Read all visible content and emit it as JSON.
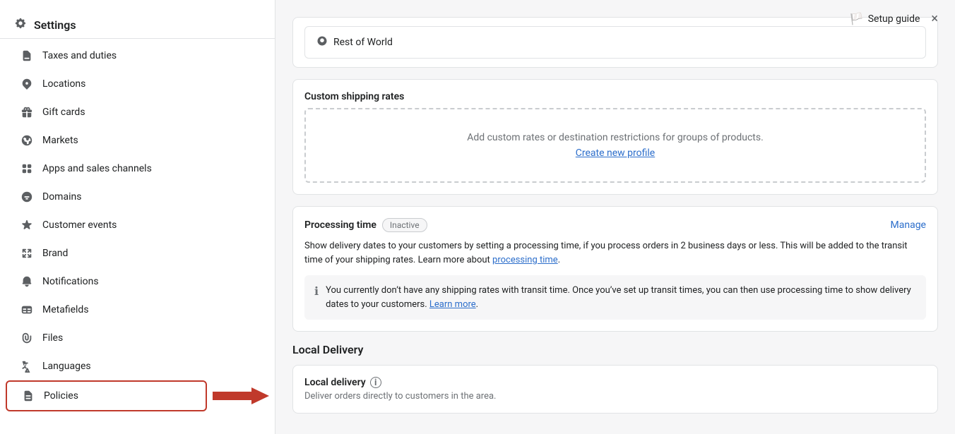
{
  "header": {
    "title": "Settings",
    "setup_guide_label": "Setup guide",
    "close_label": "×"
  },
  "sidebar": {
    "items": [
      {
        "id": "taxes",
        "label": "Taxes and duties",
        "icon": "tax"
      },
      {
        "id": "locations",
        "label": "Locations",
        "icon": "location"
      },
      {
        "id": "gift-cards",
        "label": "Gift cards",
        "icon": "gift"
      },
      {
        "id": "markets",
        "label": "Markets",
        "icon": "globe"
      },
      {
        "id": "apps",
        "label": "Apps and sales channels",
        "icon": "apps"
      },
      {
        "id": "domains",
        "label": "Domains",
        "icon": "globe2"
      },
      {
        "id": "customer-events",
        "label": "Customer events",
        "icon": "star"
      },
      {
        "id": "brand",
        "label": "Brand",
        "icon": "brand"
      },
      {
        "id": "notifications",
        "label": "Notifications",
        "icon": "bell"
      },
      {
        "id": "metafields",
        "label": "Metafields",
        "icon": "table"
      },
      {
        "id": "files",
        "label": "Files",
        "icon": "clip"
      },
      {
        "id": "languages",
        "label": "Languages",
        "icon": "translate"
      },
      {
        "id": "policies",
        "label": "Policies",
        "icon": "doc",
        "highlighted": true
      }
    ]
  },
  "main": {
    "rest_world_label": "Rest of World",
    "custom_shipping": {
      "title": "Custom shipping rates",
      "empty_text": "Add custom rates or destination restrictions for groups of products.",
      "create_link": "Create new profile"
    },
    "processing_time": {
      "title": "Processing time",
      "badge": "Inactive",
      "manage_label": "Manage",
      "description": "Show delivery dates to your customers by setting a processing time, if you process orders in 2 business days or less. This will be added to the transit time of your shipping rates. Learn more about",
      "learn_more_link": "processing time",
      "learn_more_period": ".",
      "info_text": "You currently don’t have any shipping rates with transit time. Once you’ve set up transit times, you can then use processing time to show delivery dates to your customers.",
      "info_link": "Learn more",
      "info_period": "."
    },
    "local_delivery": {
      "section_title": "Local Delivery",
      "card_title": "Local delivery",
      "card_description": "Deliver orders directly to customers in the area."
    }
  },
  "colors": {
    "link": "#2c6ecb",
    "inactive_badge_bg": "#f6f6f7",
    "inactive_badge_border": "#c9cccf",
    "red_arrow": "#c0392b"
  }
}
